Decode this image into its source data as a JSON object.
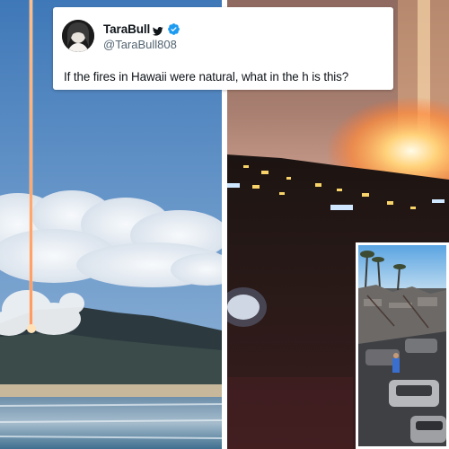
{
  "tweet": {
    "display_name": "TaraBull",
    "handle": "@TaraBull808",
    "text": "If the fires in Hawaii were natural, what in the h is this?",
    "verified": true,
    "bird_icon": "twitter-bird-icon",
    "verified_icon": "verified-badge-icon",
    "accent_color": "#1d9bf0"
  },
  "images": {
    "left": "beam-of-light-over-coastline",
    "right": "bright-flash-on-night-hillside",
    "inset": "burned-town-street-with-destroyed-cars"
  }
}
